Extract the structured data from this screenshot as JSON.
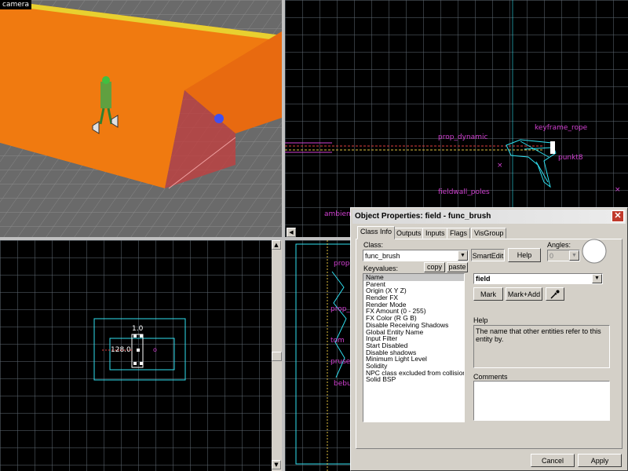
{
  "viewports": {
    "camera_label": "camera",
    "top_right_labels": [
      "prop_dynamic",
      "keyframe_rope",
      "punkt8",
      "fieldwall_poles",
      "ambien"
    ],
    "bottom_left_labels": [
      "1.0",
      "128.0"
    ],
    "bottom_right_labels": [
      "prop",
      "prop_dy",
      "tom",
      "pruse",
      "bebu"
    ]
  },
  "colors": {
    "orange_wall": "#f07a10",
    "grid_line": "#5a646e",
    "entity_label": "#d040d0",
    "cyan_wire": "#30e0f0",
    "selected_red": "#e04040"
  },
  "dialog": {
    "title": "Object Properties: field - func_brush",
    "close_icon": "close-icon",
    "tabs": [
      "Class Info",
      "Outputs",
      "Inputs",
      "Flags",
      "VisGroup"
    ],
    "class_label": "Class:",
    "class_value": "func_brush",
    "smartedit_label": "SmartEdit",
    "help_button": "Help",
    "angles_label": "Angles:",
    "angles_value": "0",
    "keyvalues_label": "Keyvalues:",
    "copy_button": "copy",
    "paste_button": "paste",
    "keyvalues": [
      "Name",
      "Parent",
      "Origin (X Y Z)",
      "Render FX",
      "Render Mode",
      "FX Amount (0 - 255)",
      "FX Color (R G B)",
      "Disable Receiving Shadows",
      "Global Entity Name",
      "Input Filter",
      "Start Disabled",
      "Disable shadows",
      "Minimum Light Level",
      "Solidity",
      "NPC class excluded from collisions",
      "Solid BSP"
    ],
    "value_field": "field",
    "mark_button": "Mark",
    "markadd_button": "Mark+Add",
    "help_section_label": "Help",
    "help_text": "The name that other entities refer to this entity by.",
    "comments_label": "Comments",
    "comments_value": "",
    "cancel_button": "Cancel",
    "apply_button": "Apply"
  }
}
